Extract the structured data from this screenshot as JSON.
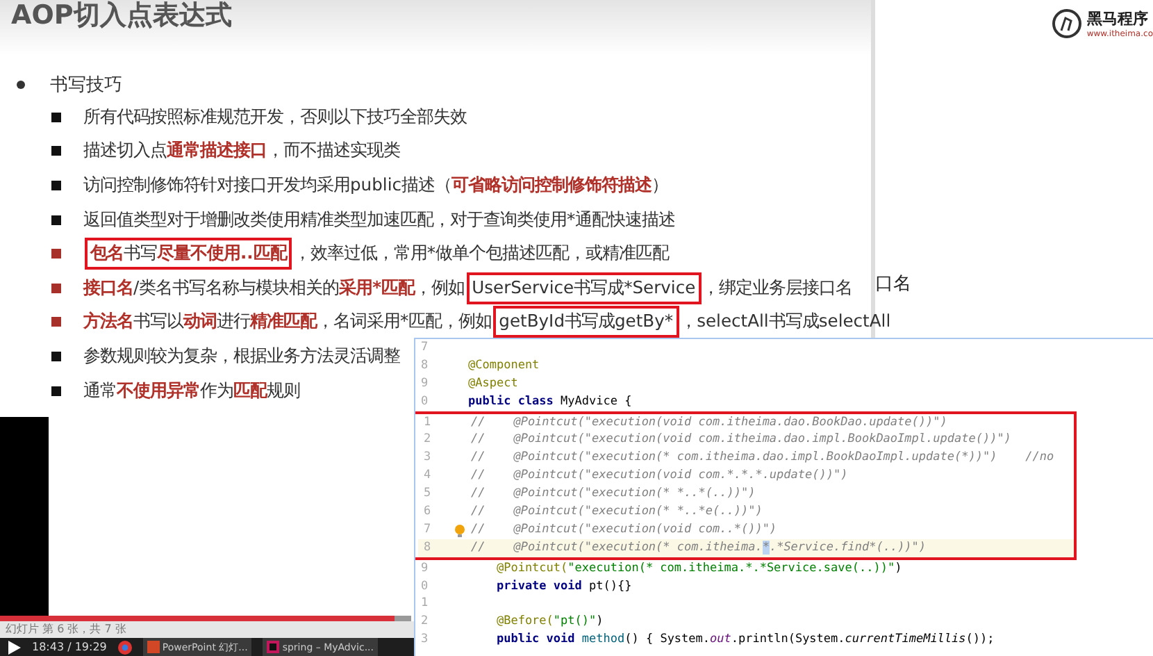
{
  "slide": {
    "title": "AOP切入点表达式",
    "heading": "书写技巧",
    "items": [
      {
        "highlighted": false,
        "before": "所有代码按照标准规范开发，否则以下技巧全部失效"
      },
      {
        "highlighted": false,
        "before": "描述切入点**通常描述接口**，而不描述实现类"
      },
      {
        "highlighted": false,
        "before": "访问控制修饰符针对接口开发均采用public描述（**可省略访问控制修饰符描述**）"
      },
      {
        "highlighted": false,
        "before": "返回值类型对于增删改类使用精准类型加速匹配，对于查询类使用*通配快速描述"
      },
      {
        "highlighted": true,
        "framed": "**包名**书写**尽量不使用..匹配**",
        "after": "，效率过低，常用*做单个包描述匹配，或精准匹配"
      },
      {
        "highlighted": true,
        "before": "**接口名**/类名书写名称与模块相关的**采用*匹配**，例如",
        "framed": "UserService书写成*Service",
        "after": "，绑定业务层接口名"
      },
      {
        "highlighted": true,
        "before": "**方法名**书写以**动词**进行**精准匹配**，名词采用*匹配，例如",
        "framed": "getById书写成getBy*",
        "after": "，selectAll书写成selectAll"
      },
      {
        "highlighted": false,
        "before": "参数规则较为复杂，根据业务方法灵活调整"
      },
      {
        "highlighted": false,
        "before": "通常**不使用异常**作为**匹配**规则"
      }
    ]
  },
  "next_slide": {
    "logo_name": "黑马程序",
    "logo_url": "www.itheima.co",
    "fragment": "口名"
  },
  "editor": {
    "before": [
      {
        "number": "7"
      },
      {
        "number": "8",
        "parts": [
          {
            "text": "@Component",
            "kind": "annotation"
          }
        ]
      },
      {
        "number": "9",
        "parts": [
          {
            "text": "@Aspect",
            "kind": "annotation"
          }
        ]
      },
      {
        "number": "0",
        "parts": [
          {
            "text": "public class ",
            "kind": "keyword"
          },
          {
            "text": "MyAdvice {",
            "kind": "plain"
          }
        ]
      }
    ],
    "framed": [
      {
        "number": "1",
        "parts": [
          {
            "text": "//    @Pointcut(\"execution(void com.itheima.dao.BookDao.update())\")",
            "kind": "comment"
          }
        ]
      },
      {
        "number": "2",
        "parts": [
          {
            "text": "//    @Pointcut(\"execution(void com.itheima.dao.impl.BookDaoImpl.update())\")",
            "kind": "comment"
          }
        ]
      },
      {
        "number": "3",
        "parts": [
          {
            "text": "//    @Pointcut(\"execution(* com.itheima.dao.impl.BookDaoImpl.update(*))\")    //no",
            "kind": "comment"
          }
        ]
      },
      {
        "number": "4",
        "parts": [
          {
            "text": "//    @Pointcut(\"execution(void com.*.*.*.update())\")",
            "kind": "comment"
          }
        ]
      },
      {
        "number": "5",
        "parts": [
          {
            "text": "//    @Pointcut(\"execution(* *..*(..))\")",
            "kind": "comment"
          }
        ]
      },
      {
        "number": "6",
        "parts": [
          {
            "text": "//    @Pointcut(\"execution(* *..*e(..))\")",
            "kind": "comment"
          }
        ]
      },
      {
        "number": "7",
        "hint": true,
        "parts": [
          {
            "text": "//    @Pointcut(\"execution(void com..*())\")",
            "kind": "comment"
          }
        ]
      },
      {
        "number": "8",
        "current": true,
        "parts": [
          {
            "text": "//    @Pointcut(\"execution(* com.itheima.",
            "kind": "comment"
          },
          {
            "text": "*",
            "kind": "selection"
          },
          {
            "text": ".*Service.find*(..))\")",
            "kind": "comment"
          }
        ]
      }
    ],
    "after": [
      {
        "number": "9",
        "parts": [
          {
            "text": "    @Pointcut(",
            "kind": "annotation"
          },
          {
            "text": "\"execution(* com.itheima.*.*Service.save(..))\"",
            "kind": "string"
          },
          {
            "text": ")",
            "kind": "plain"
          }
        ]
      },
      {
        "number": "0",
        "parts": [
          {
            "text": "    private void ",
            "kind": "keyword"
          },
          {
            "text": "pt(){}",
            "kind": "plain"
          }
        ]
      },
      {
        "number": "1"
      },
      {
        "number": "2",
        "parts": [
          {
            "text": "    @Before(",
            "kind": "annotation"
          },
          {
            "text": "\"pt()\"",
            "kind": "string"
          },
          {
            "text": ")",
            "kind": "plain"
          }
        ]
      },
      {
        "number": "3",
        "parts": [
          {
            "text": "    public void ",
            "kind": "keyword"
          },
          {
            "text": "method",
            "kind": "method"
          },
          {
            "text": "() { System.",
            "kind": "plain"
          },
          {
            "text": "out",
            "kind": "field"
          },
          {
            "text": ".println(System.",
            "kind": "plain"
          },
          {
            "text": "currentTimeMillis",
            "kind": "italic"
          },
          {
            "text": "());",
            "kind": "plain"
          }
        ]
      }
    ]
  },
  "status": "幻灯片 第 6 张，共 7 张",
  "player": {
    "time": "18:43 / 19:29",
    "level": 0.96
  },
  "taskbar": [
    {
      "label": "PowerPoint 幻灯...",
      "kind": "powerpoint"
    },
    {
      "label": "spring – MyAdvic...",
      "kind": "ide"
    }
  ]
}
